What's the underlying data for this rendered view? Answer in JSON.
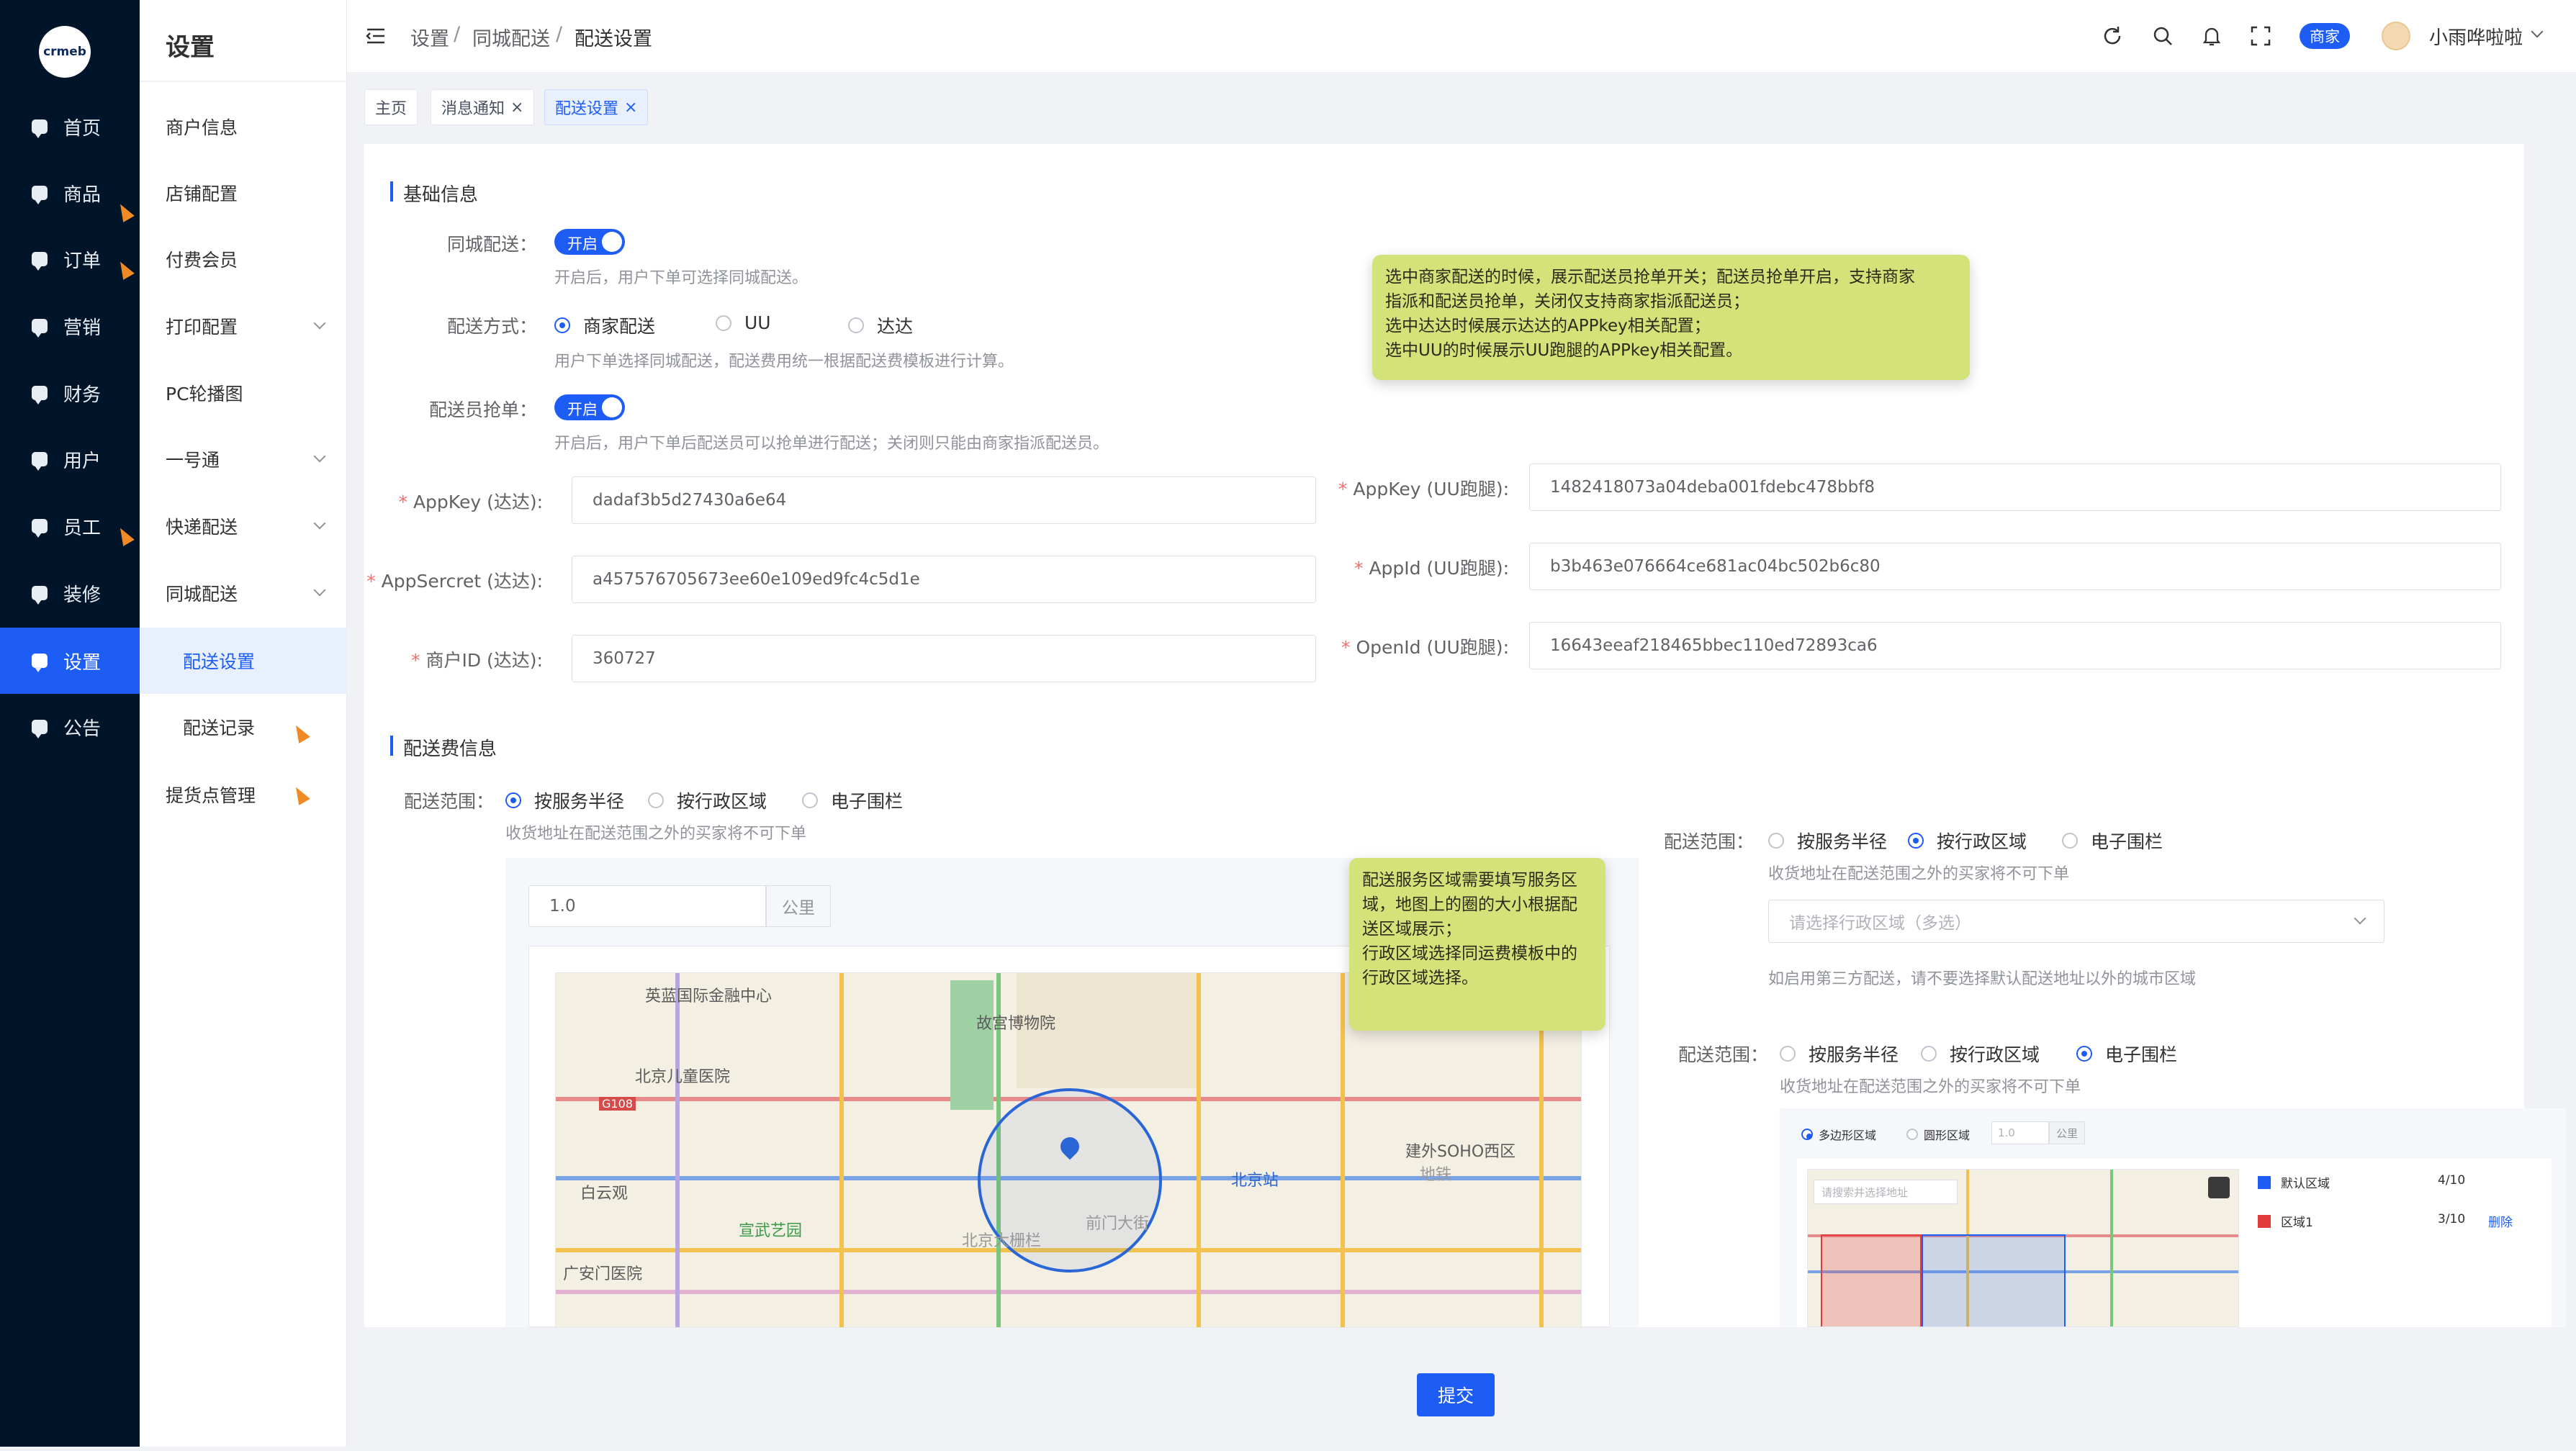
{
  "brand": {
    "logo_text": "crmeb"
  },
  "primary_nav": [
    {
      "label": "首页"
    },
    {
      "label": "商品"
    },
    {
      "label": "订单"
    },
    {
      "label": "营销"
    },
    {
      "label": "财务"
    },
    {
      "label": "用户"
    },
    {
      "label": "员工"
    },
    {
      "label": "装修"
    },
    {
      "label": "设置"
    },
    {
      "label": "公告"
    }
  ],
  "secondary_nav": {
    "title": "设置",
    "items": [
      {
        "label": "商户信息"
      },
      {
        "label": "店铺配置"
      },
      {
        "label": "付费会员"
      },
      {
        "label": "打印配置"
      },
      {
        "label": "PC轮播图"
      },
      {
        "label": "一号通"
      },
      {
        "label": "快递配送"
      },
      {
        "label": "同城配送"
      },
      {
        "label": "配送设置"
      },
      {
        "label": "配送记录"
      },
      {
        "label": "提货点管理"
      }
    ]
  },
  "header": {
    "breadcrumb": [
      "设置",
      "同城配送",
      "配送设置"
    ],
    "badge": "商家",
    "username": "小雨哗啦啦"
  },
  "tags": [
    {
      "label": "主页"
    },
    {
      "label": "消息通知"
    },
    {
      "label": "配送设置"
    }
  ],
  "basic": {
    "section_title": "基础信息",
    "city_delivery": {
      "label": "同城配送：",
      "switch": "开启",
      "hint": "开启后，用户下单可选择同城配送。"
    },
    "method": {
      "label": "配送方式：",
      "options": [
        "商家配送",
        "UU",
        "达达"
      ],
      "hint": "用户下单选择同城配送，配送费用统一根据配送费模板进行计算。"
    },
    "grab": {
      "label": "配送员抢单：",
      "switch": "开启",
      "hint": "开启后，用户下单后配送员可以抢单进行配送；关闭则只能由商家指派配送员。"
    },
    "tooltip": [
      "选中商家配送的时候，展示配送员抢单开关；配送员抢单开启，支持商家",
      "指派和配送员抢单，关闭仅支持商家指派配送员；",
      "选中达达时候展示达达的APPkey相关配置；",
      "选中UU的时候展示UU跑腿的APPkey相关配置。"
    ],
    "dada_fields": [
      {
        "label": "AppKey (达达):",
        "value": "dadaf3b5d27430a6e64"
      },
      {
        "label": "AppSercret (达达):",
        "value": "a457576705673ee60e109ed9fc4c5d1e"
      },
      {
        "label": "商户ID (达达):",
        "value": "360727"
      }
    ],
    "uu_fields": [
      {
        "label": "AppKey (UU跑腿):",
        "value": "1482418073a04deba001fdebc478bbf8"
      },
      {
        "label": "AppId (UU跑腿):",
        "value": "b3b463e076664ce681ac04bc502b6c80"
      },
      {
        "label": "OpenId (UU跑腿):",
        "value": "16643eeaf218465bbec110ed72893ca6"
      }
    ]
  },
  "fee": {
    "section_title": "配送费信息",
    "range_label": "配送范围：",
    "range_options": [
      "按服务半径",
      "按行政区域",
      "电子围栏"
    ],
    "range_hint": "收货地址在配送范围之外的买家将不可下单",
    "radius_value": "1.0",
    "radius_unit": "公里",
    "map_tooltip": [
      "配送服务区域需要填写服务区",
      "域，地图上的圈的大小根据配",
      "送区域展示；",
      "行政区域选择同运费模板中的",
      "行政区域选择。"
    ],
    "map_pois": [
      "英蓝国际金融中心",
      "故宫博物院",
      "北京儿童医院",
      "G108",
      "白云观",
      "宣武艺园",
      "广安门医院",
      "北京大栅栏",
      "前门大街",
      "北京站",
      "建外SOHO西区",
      "地铁"
    ],
    "admin_panel": {
      "range_label": "配送范围：",
      "placeholder": "请选择行政区域（多选）",
      "hint2": "如启用第三方配送，请不要选择默认配送地址以外的城市区域"
    },
    "fence_panel": {
      "range_label": "配送范围：",
      "poly_option": "多边形区域",
      "circle_option": "圆形区域",
      "circle_value": "1.0",
      "unit": "公里",
      "search_placeholder": "请搜索并选择地址",
      "areas": [
        {
          "name": "默认区域",
          "count": "4/10",
          "color": "#1d5cf5"
        },
        {
          "name": "区域1",
          "count": "3/10",
          "color": "#e03a3a",
          "action": "删除"
        }
      ]
    }
  },
  "submit_label": "提交",
  "colors": {
    "primary": "#1d5cf5",
    "sidebar": "#001529",
    "tooltip": "#d4e27a"
  }
}
